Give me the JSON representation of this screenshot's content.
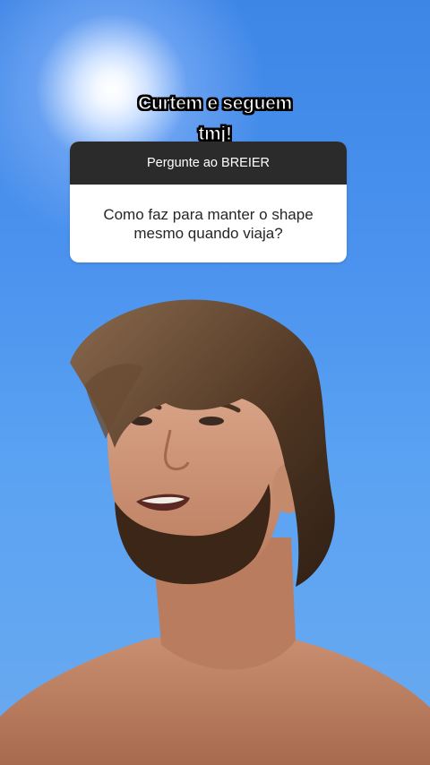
{
  "caption": {
    "line1": "Curtem e seguem",
    "line2": "tmj!"
  },
  "question_sticker": {
    "header": "Pergunte ao BREIER",
    "question": "Como faz para manter o shape mesmo quando viaja?"
  },
  "colors": {
    "sky": "#4b93ee",
    "sticker_header": "#2b2b2b",
    "sticker_body": "#ffffff"
  }
}
